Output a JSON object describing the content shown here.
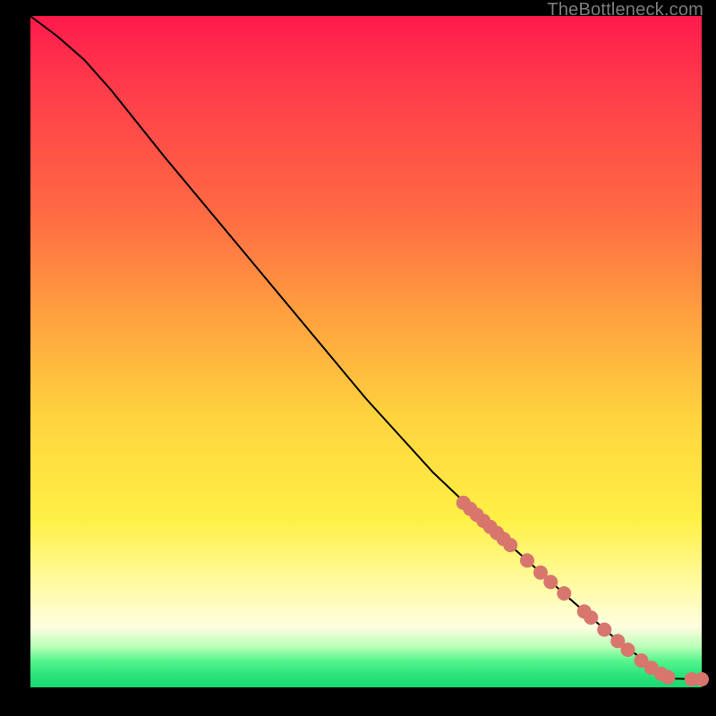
{
  "watermark": "TheBottleneck.com",
  "colors": {
    "curve_stroke": "#000000",
    "marker_fill": "#d8766d",
    "marker_stroke": "#bb5f58"
  },
  "chart_data": {
    "type": "line",
    "title": "",
    "xlabel": "",
    "ylabel": "",
    "xlim": [
      0,
      100
    ],
    "ylim": [
      0,
      100
    ],
    "curve": [
      {
        "x": 0,
        "y": 100
      },
      {
        "x": 4,
        "y": 97
      },
      {
        "x": 8,
        "y": 93.5
      },
      {
        "x": 12,
        "y": 89
      },
      {
        "x": 20,
        "y": 79
      },
      {
        "x": 30,
        "y": 67
      },
      {
        "x": 40,
        "y": 55
      },
      {
        "x": 50,
        "y": 43
      },
      {
        "x": 60,
        "y": 32
      },
      {
        "x": 70,
        "y": 22.5
      },
      {
        "x": 80,
        "y": 13.5
      },
      {
        "x": 88,
        "y": 6.5
      },
      {
        "x": 94,
        "y": 2.2
      },
      {
        "x": 96,
        "y": 1.3
      },
      {
        "x": 100,
        "y": 1.2
      }
    ],
    "markers": [
      {
        "x": 64.5,
        "y": 27.5
      },
      {
        "x": 65.5,
        "y": 26.6
      },
      {
        "x": 66.5,
        "y": 25.7
      },
      {
        "x": 67.5,
        "y": 24.8
      },
      {
        "x": 68.5,
        "y": 23.9
      },
      {
        "x": 69.5,
        "y": 23.0
      },
      {
        "x": 70.5,
        "y": 22.1
      },
      {
        "x": 71.5,
        "y": 21.2
      },
      {
        "x": 74.0,
        "y": 18.9
      },
      {
        "x": 76.0,
        "y": 17.1
      },
      {
        "x": 77.5,
        "y": 15.7
      },
      {
        "x": 79.5,
        "y": 14.0
      },
      {
        "x": 82.5,
        "y": 11.3
      },
      {
        "x": 83.5,
        "y": 10.4
      },
      {
        "x": 85.5,
        "y": 8.6
      },
      {
        "x": 87.5,
        "y": 6.9
      },
      {
        "x": 89.0,
        "y": 5.6
      },
      {
        "x": 91.0,
        "y": 4.0
      },
      {
        "x": 92.5,
        "y": 2.9
      },
      {
        "x": 94.0,
        "y": 2.0
      },
      {
        "x": 95.0,
        "y": 1.5
      },
      {
        "x": 98.5,
        "y": 1.2
      },
      {
        "x": 100.0,
        "y": 1.2
      }
    ]
  }
}
